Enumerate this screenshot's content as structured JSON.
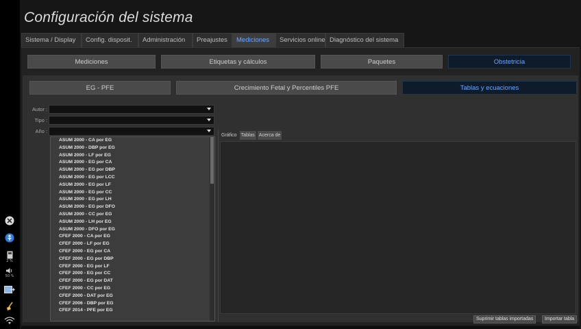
{
  "title": "Configuración del sistema",
  "tabs": [
    {
      "label": "Sistema / Display"
    },
    {
      "label": "Config. disposit."
    },
    {
      "label": "Administración"
    },
    {
      "label": "Preajustes"
    },
    {
      "label": "Mediciones",
      "active": true
    },
    {
      "label": "Servicios online"
    },
    {
      "label": "Diagnóstico del sistema"
    }
  ],
  "sections": [
    {
      "label": "Mediciones"
    },
    {
      "label": "Etiquetas y cálculos"
    },
    {
      "label": "Paquetes"
    },
    {
      "label": "Obstetricia",
      "active": true
    }
  ],
  "subsections": [
    {
      "label": "EG - PFE"
    },
    {
      "label": "Crecimiento Fetal y Percentiles PFE"
    },
    {
      "label": "Tablas y ecuaciones",
      "active": true
    }
  ],
  "filters": {
    "author_label": "Autor :",
    "author_value": "",
    "type_label": "Tipo :",
    "type_value": "",
    "year_label": "Año :",
    "year_value": ""
  },
  "table_list": [
    "ASUM 2000 - CA por EG",
    "ASUM 2000 - DBP por EG",
    "ASUM 2000 - LF por EG",
    "ASUM 2000 - EG por CA",
    "ASUM 2000 - EG por DBP",
    "ASUM 2000 - EG por LCC",
    "ASUM 2000 - EG por LF",
    "ASUM 2000 - EG por CC",
    "ASUM 2000 - EG por LH",
    "ASUM 2000 - EG por DFO",
    "ASUM 2000 - CC por EG",
    "ASUM 2000 - LH por EG",
    "ASUM 2000 - DFO por EG",
    "CFEF 2000 - CA por EG",
    "CFEF 2000 - LF por EG",
    "CFEF 2000 - EG por CA",
    "CFEF 2000 - EG por DBP",
    "CFEF 2000 - EG por LF",
    "CFEF 2000 - EG por CC",
    "CFEF 2000 - EG por DAT",
    "CFEF 2000 - CC por EG",
    "CFEF 2000 - DAT por EG",
    "CFEF 2006 - DBP por EG",
    "CFEF 2014 - PFE por EG"
  ],
  "detail_tabs": [
    {
      "label": "Gráfico"
    },
    {
      "label": "Tablas"
    },
    {
      "label": "Acerca de"
    }
  ],
  "actions": {
    "delete_imported": "Suprimir tablas importadas",
    "import_table": "Importar tabla"
  },
  "sidebar": {
    "storage_percent": "2 %",
    "volume_percent": "50 %"
  },
  "colors": {
    "accent": "#6fa8ff",
    "active_button_bg": "#0d1b2b"
  }
}
